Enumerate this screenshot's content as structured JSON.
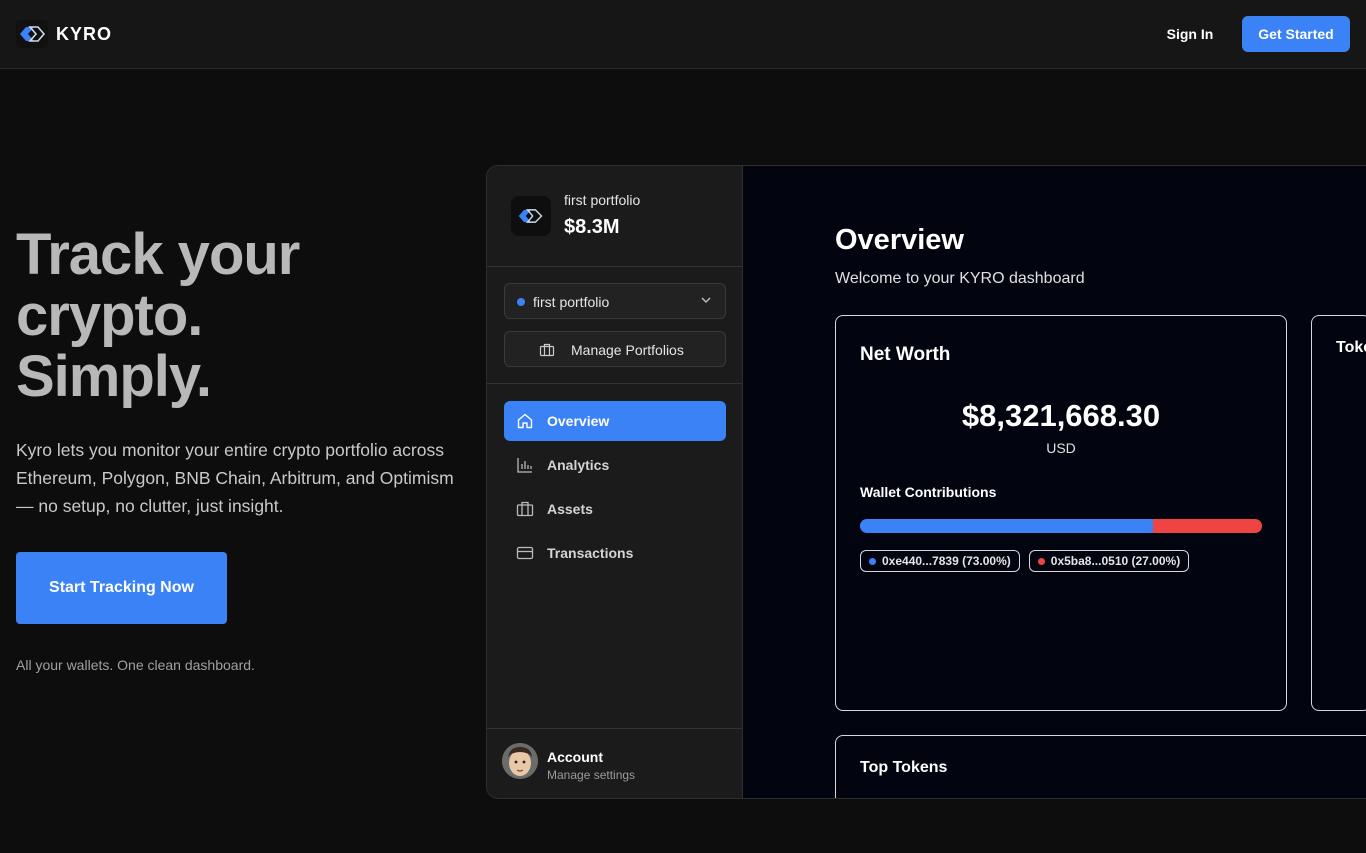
{
  "nav": {
    "brand": "KYRO",
    "sign_in": "Sign In",
    "get_started": "Get Started"
  },
  "hero": {
    "title_lines": [
      "Track your",
      "crypto.",
      "Simply."
    ],
    "description": "Kyro lets you monitor your entire crypto portfolio across Ethereum, Polygon, BNB Chain, Arbitrum, and Optimism — no setup, no clutter, just insight.",
    "cta": "Start Tracking Now",
    "tagline": "All your wallets. One clean dashboard."
  },
  "dashboard": {
    "sidebar": {
      "portfolio_name": "first portfolio",
      "portfolio_value": "$8.3M",
      "selector_label": "first portfolio",
      "manage_label": "Manage Portfolios",
      "items": [
        {
          "label": "Overview",
          "icon": "home-icon",
          "active": true
        },
        {
          "label": "Analytics",
          "icon": "bar-chart-icon",
          "active": false
        },
        {
          "label": "Assets",
          "icon": "briefcase-icon",
          "active": false
        },
        {
          "label": "Transactions",
          "icon": "credit-card-icon",
          "active": false
        }
      ],
      "account_name": "Account",
      "account_sub": "Manage settings"
    },
    "main": {
      "title": "Overview",
      "subtitle": "Welcome to your KYRO dashboard",
      "net_worth": {
        "title": "Net Worth",
        "value": "$8,321,668.30",
        "currency": "USD",
        "contributions_title": "Wallet Contributions",
        "wallets": [
          {
            "label": "0xe440...7839 (73.00%)",
            "share": 73.0,
            "color": "#3b82f6"
          },
          {
            "label": "0x5ba8...0510 (27.00%)",
            "share": 27.0,
            "color": "#ef4444"
          }
        ]
      },
      "tokens_card_title": "Toke",
      "top_tokens_title": "Top Tokens"
    }
  },
  "colors": {
    "accent": "#3b82f6",
    "danger": "#ef4444",
    "background": "#0d0d0d"
  }
}
